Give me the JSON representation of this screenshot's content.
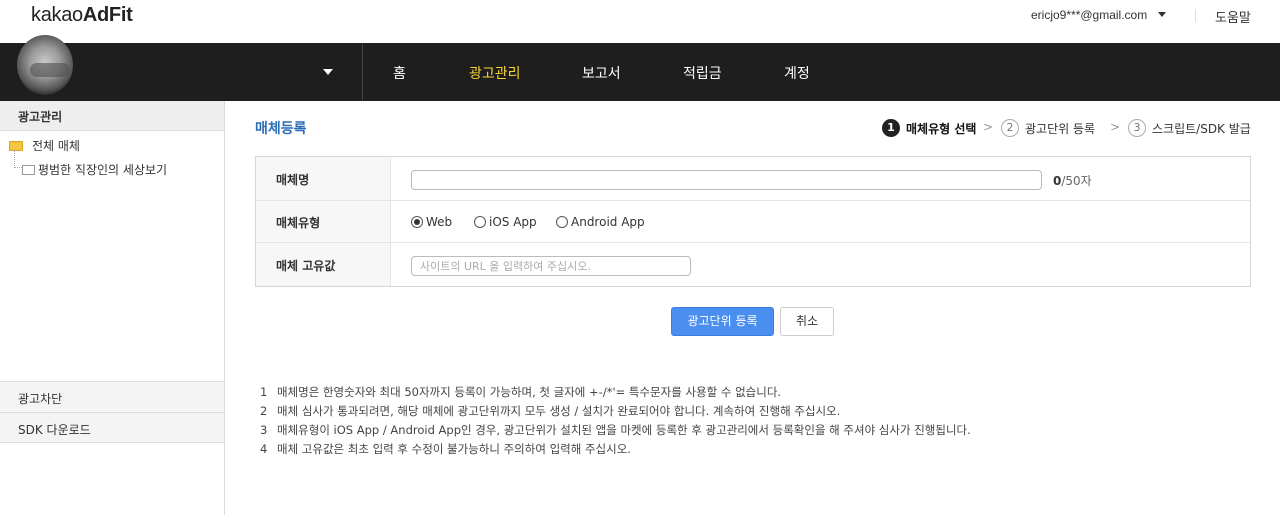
{
  "header": {
    "logo_light": "kakao",
    "logo_bold": "AdFit",
    "user_email": "ericjo9***@gmail.com",
    "help_label": "도움말"
  },
  "nav": {
    "items": [
      {
        "label": "홈",
        "active": false
      },
      {
        "label": "광고관리",
        "active": true
      },
      {
        "label": "보고서",
        "active": false
      },
      {
        "label": "적립금",
        "active": false
      },
      {
        "label": "계정",
        "active": false
      }
    ]
  },
  "sidebar": {
    "section_title": "광고관리",
    "tree_root": "전체 매체",
    "tree_child": "평범한 직장인의 세상보기",
    "bottom_sections": [
      "광고차단",
      "SDK 다운로드"
    ]
  },
  "page": {
    "title": "매체등록",
    "steps": [
      {
        "num": "1",
        "label": "매체유형 선택",
        "active": true
      },
      {
        "num": "2",
        "label": "광고단위 등록",
        "active": false
      },
      {
        "num": "3",
        "label": "스크립트/SDK 발급",
        "active": false
      }
    ],
    "step_arrow": ">"
  },
  "form": {
    "name_label": "매체명",
    "name_value": "",
    "name_count_current": "0",
    "name_count_suffix": "/50자",
    "type_label": "매체유형",
    "type_options": [
      {
        "label": "Web",
        "selected": true
      },
      {
        "label": "iOS App",
        "selected": false
      },
      {
        "label": "Android App",
        "selected": false
      }
    ],
    "id_label": "매체 고유값",
    "id_placeholder": "사이트의 URL 을 입력하여 주십시오."
  },
  "buttons": {
    "submit": "광고단위 등록",
    "cancel": "취소"
  },
  "notes": [
    {
      "num": "1",
      "text": "매체명은 한영숫자와 최대 50자까지 등록이 가능하며, 첫 글자에 +-/*'= 특수문자를 사용할 수 없습니다."
    },
    {
      "num": "2",
      "text": "매체 심사가 통과되려면, 해당 매체에 광고단위까지 모두 생성 / 설치가 완료되어야 합니다. 계속하여 진행해 주십시오."
    },
    {
      "num": "3",
      "text": "매체유형이 iOS App / Android App인 경우, 광고단위가 설치된 앱을 마켓에 등록한 후 광고관리에서 등록확인을 해 주셔야 심사가 진행됩니다."
    },
    {
      "num": "4",
      "text": "매체 고유값은 최초 입력 후 수정이 불가능하니 주의하여 입력해 주십시오."
    }
  ],
  "colors": {
    "nav_bg": "#1e1e1e",
    "nav_active": "#f7d634",
    "title_blue": "#2c6eb6",
    "primary_button": "#4a8ff0"
  }
}
